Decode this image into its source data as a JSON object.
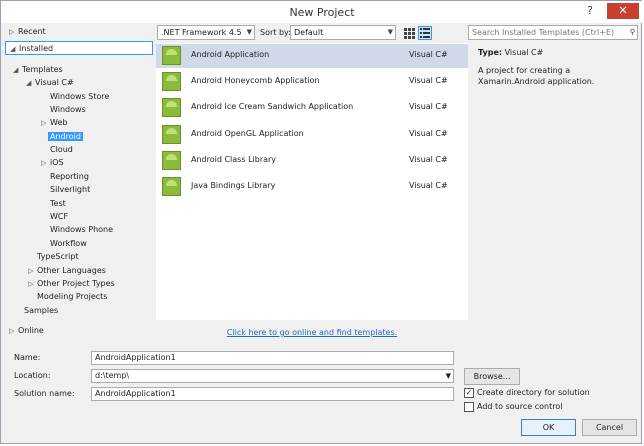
{
  "window": {
    "title": "New Project",
    "help": "?",
    "close": "✕"
  },
  "tree": {
    "recent": "Recent",
    "installed": "Installed",
    "templates": "Templates",
    "visual_cs": "Visual C#",
    "items": [
      "Windows Store",
      "Windows",
      "Web",
      "Android",
      "Cloud",
      "iOS",
      "Reporting",
      "Silverlight",
      "Test",
      "WCF",
      "Windows Phone",
      "Workflow"
    ],
    "typescript": "TypeScript",
    "other_languages": "Other Languages",
    "other_project_types": "Other Project Types",
    "modeling_projects": "Modeling Projects",
    "samples": "Samples",
    "online": "Online"
  },
  "toolbar": {
    "framework": ".NET Framework 4.5",
    "sort_label": "Sort by:",
    "sort_value": "Default",
    "search_placeholder": "Search Installed Templates (Ctrl+E)"
  },
  "templates": [
    {
      "name": "Android Application",
      "lang": "Visual C#"
    },
    {
      "name": "Android Honeycomb Application",
      "lang": "Visual C#"
    },
    {
      "name": "Android Ice Cream Sandwich Application",
      "lang": "Visual C#"
    },
    {
      "name": "Android OpenGL Application",
      "lang": "Visual C#"
    },
    {
      "name": "Android Class Library",
      "lang": "Visual C#"
    },
    {
      "name": "Java Bindings Library",
      "lang": "Visual C#"
    }
  ],
  "details": {
    "type_label": "Type:",
    "type_value": "Visual C#",
    "description": "A project for creating a Xamarin.Android application."
  },
  "online_link": "Click here to go online and find templates.",
  "form": {
    "name_label": "Name:",
    "name_value": "AndroidApplication1",
    "location_label": "Location:",
    "location_value": "d:\\temp\\",
    "solution_label": "Solution name:",
    "solution_value": "AndroidApplication1",
    "browse": "Browse...",
    "create_dir": "Create directory for solution",
    "source_control": "Add to source control",
    "ok": "OK",
    "cancel": "Cancel"
  },
  "colors": {
    "accent": "#3399ff",
    "selected_item": "#cfd9e8",
    "link": "#1e66c8",
    "close": "#c7402f"
  }
}
